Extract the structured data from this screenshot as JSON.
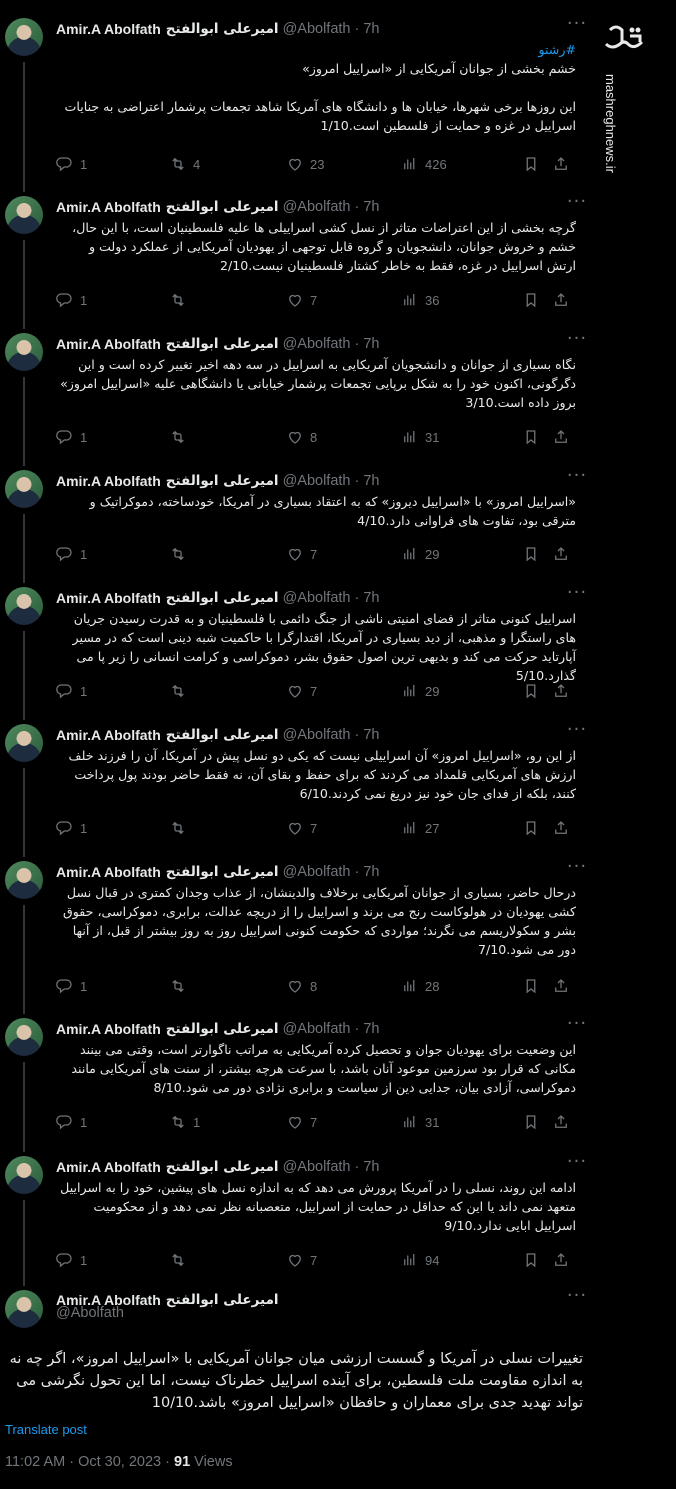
{
  "author": {
    "name_fa": "امیرعلی ابوالفتح",
    "name_en": "Amir.A Abolfath",
    "handle": "@Abolfath",
    "time": "7h"
  },
  "more_label": "···",
  "tweets": [
    {
      "hashtag": "#رشتو",
      "text": "خشم بخشی از جوانان آمریکایی از «اسراییل امروز»\n\nاین روزها برخی شهرها، خیابان ها و دانشگاه های آمریکا شاهد تجمعات پرشمار اعتراضی به جنایات اسراییل در غزه و حمایت از فلسطین است.1/10",
      "replies": "1",
      "reposts": "4",
      "likes": "23",
      "views": "426"
    },
    {
      "hashtag": "",
      "text": "گرچه بخشی از این اعتراضات متاثر از نسل کشی اسراییلی ها علیه فلسطینیان است، با این حال، خشم و خروش جوانان، دانشجویان و گروه قابل توجهی از یهودیان آمریکایی از عملکرد دولت و ارتش اسراییل در غزه، فقط به خاطر کشتار فلسطینیان نیست.2/10",
      "replies": "1",
      "reposts": "",
      "likes": "7",
      "views": "36"
    },
    {
      "hashtag": "",
      "text": "نگاه بسیاری از جوانان و دانشجویان آمریکایی به اسراییل در سه دهه اخیر تغییر کرده است و این دگرگونی، اکنون خود را به شکل برپایی تجمعات پرشمار خیابانی یا دانشگاهی علیه «اسراییل امروز» بروز داده است.3/10",
      "replies": "1",
      "reposts": "",
      "likes": "8",
      "views": "31"
    },
    {
      "hashtag": "",
      "text": "«اسراییل امروز» با «اسراییل دیروز» که به اعتقاد بسیاری در آمریکا، خودساخته، دموکراتیک و مترقی بود، تفاوت های فراوانی دارد.4/10",
      "replies": "1",
      "reposts": "",
      "likes": "7",
      "views": "29"
    },
    {
      "hashtag": "",
      "text": "اسراییل کنونی متاثر از فضای امنیتی ناشی از جنگ دائمی با فلسطینیان و به قدرت رسیدن جریان های راستگرا و مذهبی، از دید بسیاری در آمریکا، اقتدارگرا با حاکمیت شبه دینی است که در مسیر آپارتاید حرکت می کند و بدیهی ترین اصول حقوق بشر، دموکراسی و کرامت انسانی را زیر پا می گذارد.5/10",
      "replies": "1",
      "reposts": "",
      "likes": "7",
      "views": "29"
    },
    {
      "hashtag": "",
      "text": "از این رو، «اسراییل امروز» آن اسراییلی نیست که یکی دو نسل پیش در آمریکا، آن را فرزند خلف ارزش های آمریکایی قلمداد می کردند که برای حفظ و بقای آن، نه فقط حاضر بودند پول پرداخت کنند، بلکه از فدای جان خود نیز دریغ نمی کردند.6/10",
      "replies": "1",
      "reposts": "",
      "likes": "7",
      "views": "27"
    },
    {
      "hashtag": "",
      "text": "درحال حاضر، بسیاری از جوانان آمریکایی برخلاف والدینشان، از عذاب وجدان کمتری در قبال نسل کشی یهودیان در هولوکاست رنج می برند و اسراییل را از دریچه عدالت، برابری، دموکراسی، حقوق بشر و سکولاریسم می نگرند؛ مواردی که حکومت کنونی اسراییل روز به روز بیشتر از قبل، از آنها دور می شود.7/10",
      "replies": "1",
      "reposts": "",
      "likes": "8",
      "views": "28"
    },
    {
      "hashtag": "",
      "text": "این وضعیت برای یهودیان جوان و تحصیل کرده آمریکایی به مراتب ناگوارتر است، وقتی می بینند مکانی که قرار بود سرزمین موعود آنان باشد، با سرعت هرچه بیشتر، از سنت های آمریکایی مانند دموکراسی، آزادی بیان، جدایی دین از سیاست و برابری نژادی دور می شود.8/10",
      "replies": "1",
      "reposts": "1",
      "likes": "7",
      "views": "31"
    },
    {
      "hashtag": "",
      "text": "ادامه این روند، نسلی را در آمریکا پرورش می دهد که به اندازه نسل های پیشین، خود را به اسراییل متعهد نمی داند یا این که حداقل در حمایت از اسراییل، متعصبانه نظر نمی دهد و از محکومیت اسراییل ابایی ندارد.9/10",
      "replies": "1",
      "reposts": "",
      "likes": "7",
      "views": "94"
    }
  ],
  "main_tweet": {
    "text": "تغییرات نسلی در آمریکا و گسست ارزشی میان جوانان آمریکایی با «اسراییل امروز»، اگر چه نه به اندازه مقاومت ملت فلسطین، برای آینده اسراییل خطرناک نیست، اما این تحول نگرشی می تواند تهدید جدی برای معماران و حافظان «اسراییل امروز» باشد.10/10",
    "translate_label": "Translate post",
    "timestamp": "11:02 AM · Oct 30, 2023 · ",
    "views_count": "91",
    "views_label": " Views"
  },
  "watermark": {
    "logo_text": "مشرق",
    "site": "mashreghnews.ir"
  },
  "colors": {
    "background": "#000000",
    "text": "#e7e9ea",
    "muted": "#71767b",
    "link": "#1d9bf0",
    "thread_line": "#333639"
  }
}
